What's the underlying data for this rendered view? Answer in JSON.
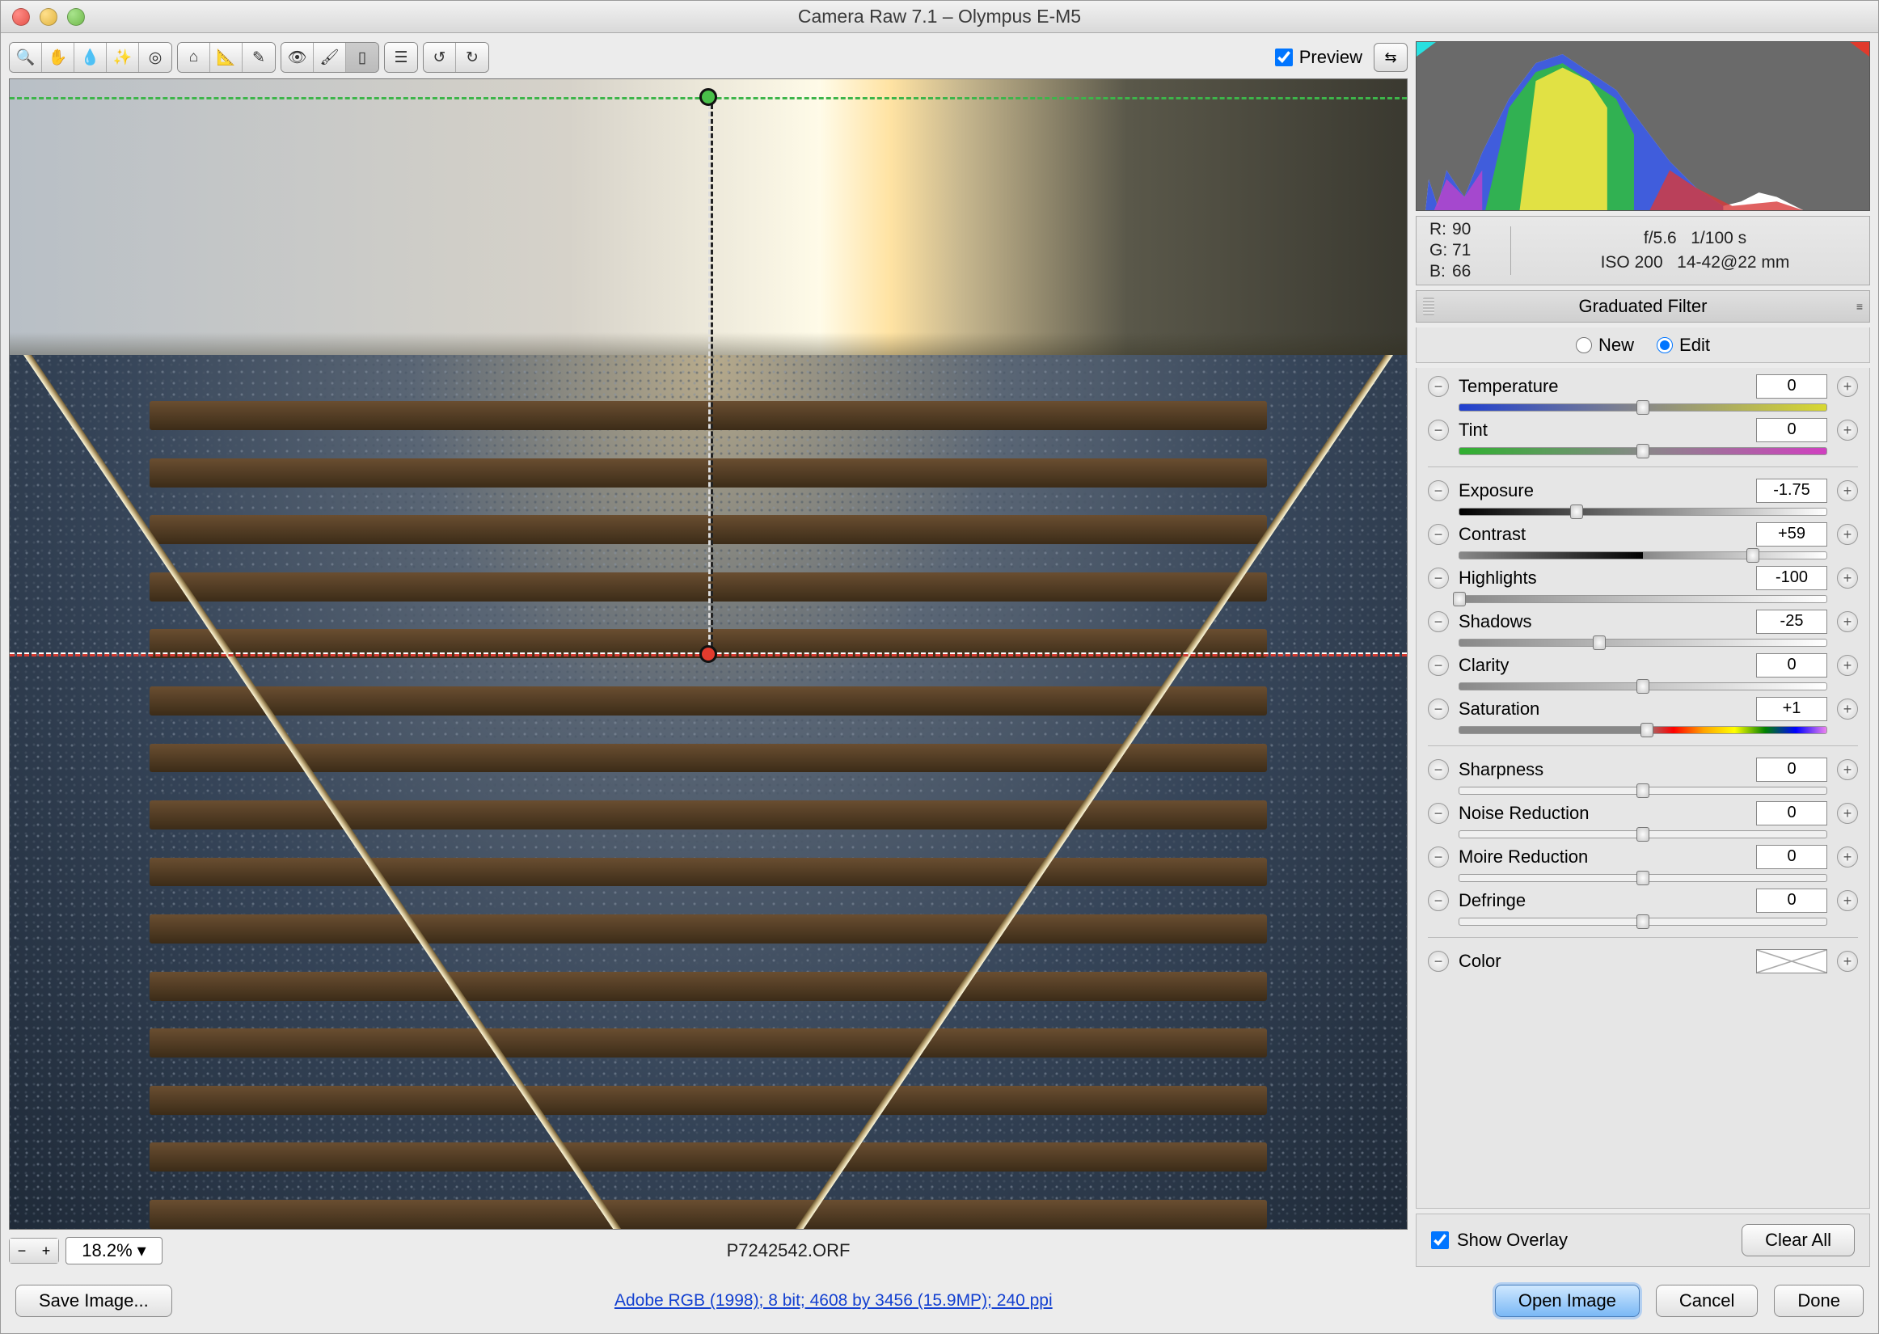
{
  "window": {
    "title": "Camera Raw 7.1  –  Olympus E-M5"
  },
  "toolbar": {
    "preview_label": "Preview",
    "preview_checked": true
  },
  "zoom": {
    "minus": "−",
    "plus": "+",
    "value": "18.2%"
  },
  "filename": "P7242542.ORF",
  "footer": {
    "save_image": "Save Image...",
    "workflow_link": "Adobe RGB (1998); 8 bit; 4608 by 3456 (15.9MP); 240 ppi",
    "open_image": "Open Image",
    "cancel": "Cancel",
    "done": "Done"
  },
  "meta": {
    "r_label": "R:",
    "r": "90",
    "g_label": "G:",
    "g": "71",
    "b_label": "B:",
    "b": "66",
    "aperture": "f/5.6",
    "shutter": "1/100 s",
    "iso": "ISO 200",
    "lens": "14-42@22 mm"
  },
  "panel": {
    "title": "Graduated Filter",
    "mode_new": "New",
    "mode_edit": "Edit",
    "mode_selected": "edit"
  },
  "sliders": {
    "temperature": {
      "label": "Temperature",
      "value": "0",
      "pos": 50
    },
    "tint": {
      "label": "Tint",
      "value": "0",
      "pos": 50
    },
    "exposure": {
      "label": "Exposure",
      "value": "-1.75",
      "pos": 32
    },
    "contrast": {
      "label": "Contrast",
      "value": "+59",
      "pos": 80
    },
    "highlights": {
      "label": "Highlights",
      "value": "-100",
      "pos": 0
    },
    "shadows": {
      "label": "Shadows",
      "value": "-25",
      "pos": 38
    },
    "clarity": {
      "label": "Clarity",
      "value": "0",
      "pos": 50
    },
    "saturation": {
      "label": "Saturation",
      "value": "+1",
      "pos": 51
    },
    "sharpness": {
      "label": "Sharpness",
      "value": "0",
      "pos": 50
    },
    "noise": {
      "label": "Noise Reduction",
      "value": "0",
      "pos": 50
    },
    "moire": {
      "label": "Moire Reduction",
      "value": "0",
      "pos": 50
    },
    "defringe": {
      "label": "Defringe",
      "value": "0",
      "pos": 50
    },
    "color": {
      "label": "Color"
    }
  },
  "overlay": {
    "show_overlay": "Show Overlay",
    "clear_all": "Clear All"
  }
}
